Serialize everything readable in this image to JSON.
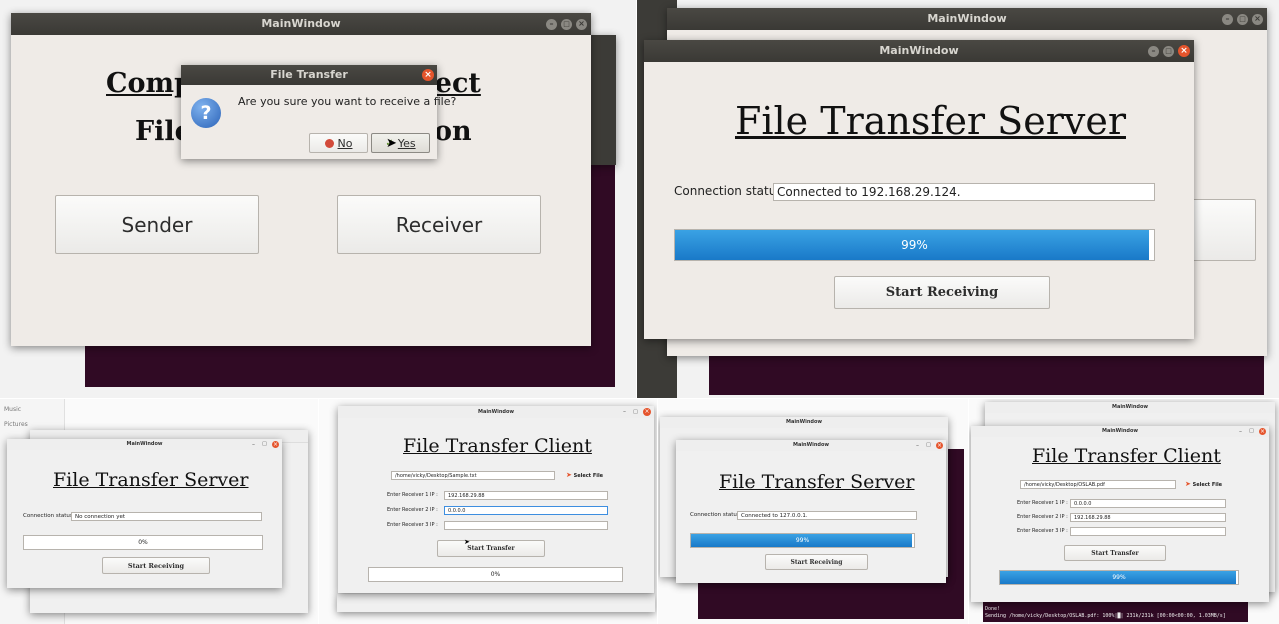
{
  "colors": {
    "accent_blue": "#1f86d6",
    "titlebar": "#3c3b37",
    "window_bg": "#efebe7",
    "close_orange": "#e5542c",
    "terminal": "#300a24"
  },
  "p1": {
    "window_title": "MainWindow",
    "title_line1_left": "Comp",
    "title_line1_right": "ject",
    "title_line2_left": "File",
    "title_line2_right": "on",
    "sender_label": "Sender",
    "receiver_label": "Receiver",
    "dialog": {
      "title": "File Transfer",
      "message": "Are you sure you want to receive a file?",
      "icon": "question-icon",
      "no_label": "No",
      "yes_label": "Yes"
    }
  },
  "p2": {
    "back_window_title": "MainWindow",
    "window_title": "MainWindow",
    "heading": "File Transfer Server",
    "status_label": "Connection status :",
    "status_value": "Connected to 192.168.29.124.",
    "progress_text": "99%",
    "progress_value": 99,
    "button_label": "Start Receiving"
  },
  "p3": {
    "sidebar_items": [
      "Music",
      "Pictures"
    ],
    "window_title": "MainWindow",
    "heading": "File Transfer Server",
    "status_label": "Connection status :",
    "status_value": "No connection yet",
    "progress_text": "0%",
    "button_label": "Start Receiving"
  },
  "p4": {
    "window_title": "MainWindow",
    "heading": "File Transfer Client",
    "file_path": "/home/vicky/Desktop/Sample.txt",
    "select_label": "Select File",
    "ip1_label": "Enter Receiver 1 IP :",
    "ip1_value": "192.168.29.88",
    "ip2_label": "Enter Receiver 2 IP :",
    "ip2_value": "0.0.0.0",
    "ip3_label": "Enter Receiver 3 IP :",
    "ip3_value": "",
    "button_label": "Start Transfer",
    "progress_text": "0%"
  },
  "p5": {
    "back_window_title": "MainWindow",
    "window_title": "MainWindow",
    "heading": "File Transfer Server",
    "status_label": "Connection status :",
    "status_value": "Connected to 127.0.0.1.",
    "progress_text": "99%",
    "progress_value": 99,
    "button_label": "Start Receiving"
  },
  "p6": {
    "back_window_title": "MainWindow",
    "window_title": "MainWindow",
    "heading": "File Transfer Client",
    "file_path": "/home/vicky/Desktop/OSLAB.pdf",
    "select_label": "Select File",
    "ip1_label": "Enter Receiver 1 IP :",
    "ip1_value": "0.0.0.0",
    "ip2_label": "Enter Receiver 2 IP :",
    "ip2_value": "192.168.29.88",
    "ip3_label": "Enter Receiver 3 IP :",
    "ip3_value": "",
    "button_label": "Start Transfer",
    "progress_text": "99%",
    "progress_value": 99,
    "terminal_line1": "Done!",
    "terminal_line2": "Sending /home/vicky/Desktop/OSLAB.pdf: 100%|█| 231k/231k [00:00<00:00, 1.03MB/s]"
  }
}
